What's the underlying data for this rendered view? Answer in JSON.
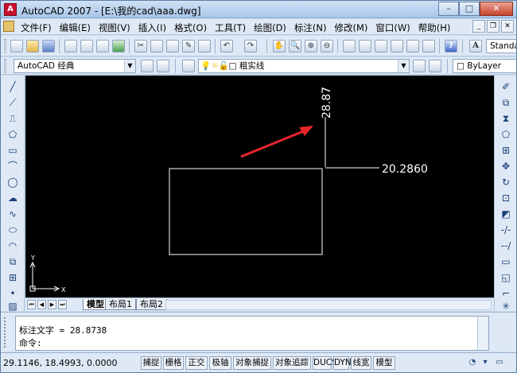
{
  "window": {
    "title": "AutoCAD 2007 - [E:\\我的cad\\aaa.dwg]",
    "app_icon_label": "A",
    "minimize_glyph": "–",
    "maximize_glyph": "□",
    "close_glyph": "✕"
  },
  "menu": {
    "items": [
      "文件(F)",
      "编辑(E)",
      "视图(V)",
      "插入(I)",
      "格式(O)",
      "工具(T)",
      "绘图(D)",
      "标注(N)",
      "修改(M)",
      "窗口(W)",
      "帮助(H)"
    ],
    "mdi_minimize": "_",
    "mdi_restore": "❐",
    "mdi_close": "✕"
  },
  "toolbar_standard": {
    "text_style_combo": "Standa",
    "text_style_icon": "A"
  },
  "toolbar_layers": {
    "workspace_combo": "AutoCAD 经典",
    "layer_combo": "粗实线",
    "color_combo": "ByLayer"
  },
  "drawing": {
    "dimension_vertical": "28.87",
    "dimension_horizontal": "20.2860",
    "ucs_x_label": "X",
    "ucs_y_label": "Y",
    "colors": {
      "background": "#000000",
      "geometry": "#ffffff",
      "arrow": "#e8262b"
    }
  },
  "layout_tabs": {
    "tabs": [
      "模型",
      "布局1",
      "布局2"
    ],
    "active": "模型"
  },
  "command_window": {
    "history_line": "标注文字 = 28.8738",
    "prompt": "命令:"
  },
  "status_bar": {
    "coordinates": "29.1146, 18.4993, 0.0000",
    "buttons": [
      "捕捉",
      "栅格",
      "正交",
      "极轴",
      "对象捕捉",
      "对象追踪",
      "DUCS",
      "DYN",
      "线宽",
      "模型"
    ]
  }
}
